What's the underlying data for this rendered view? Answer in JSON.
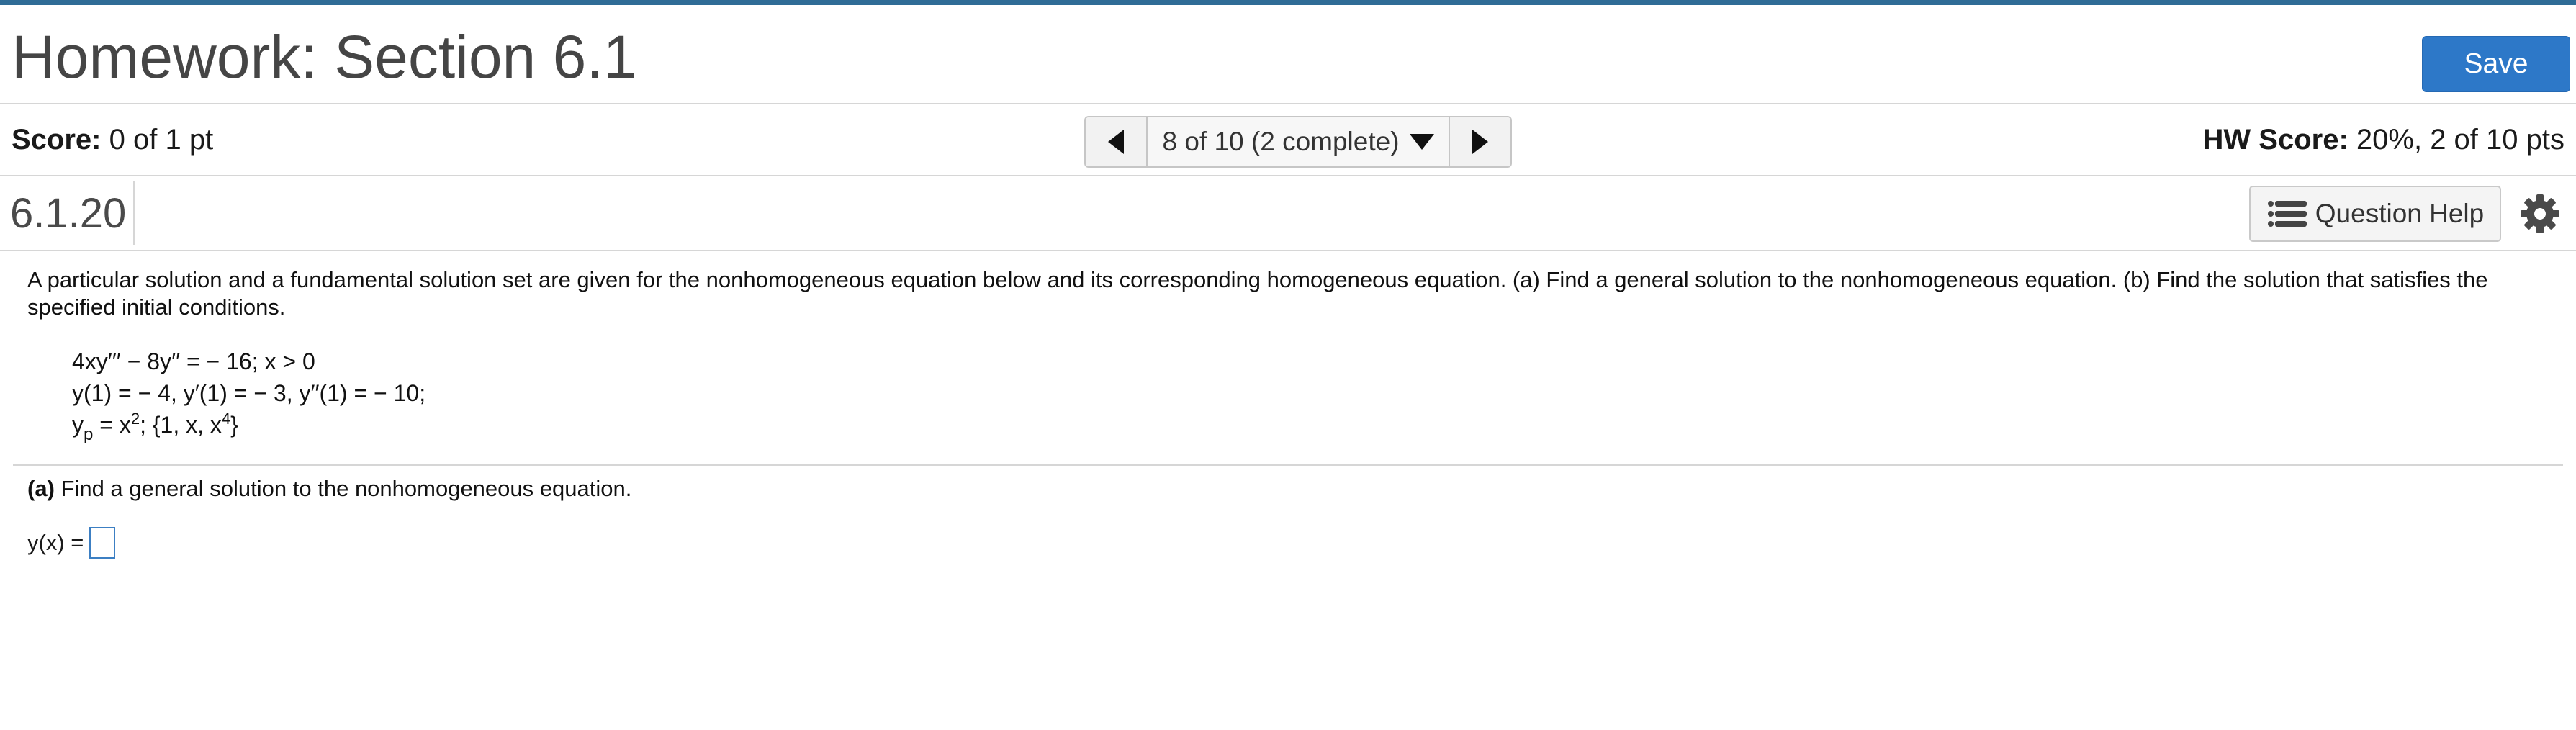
{
  "header": {
    "title": "Homework: Section 6.1",
    "save_label": "Save"
  },
  "score": {
    "label": "Score:",
    "value": "0 of 1 pt",
    "hw_label": "HW Score:",
    "hw_value": "20%, 2 of 10 pts"
  },
  "nav": {
    "status": "8 of 10 (2 complete)"
  },
  "question": {
    "id": "6.1.20",
    "help_label": "Question Help",
    "prompt": "A particular solution and a fundamental solution set are given for the nonhomogeneous equation below and its corresponding homogeneous equation. (a) Find a general solution to the nonhomogeneous equation. (b) Find the solution that satisfies the specified initial conditions.",
    "equation": "4xy′′′ − 8y′′ = − 16; x > 0",
    "initial_conditions": "y(1) = − 4, y′(1) = − 3, y′′(1) = − 10;",
    "yp_var": "y",
    "yp_sub": "p",
    "yp_rhs_pre": " = x",
    "yp_rhs_exp": "2",
    "yp_set_pre": "; {1, x, x",
    "yp_set_exp": "4",
    "yp_set_post": "}"
  },
  "part_a": {
    "label": "(a)",
    "text": " Find a general solution to the nonhomogeneous equation.",
    "answer_label": "y(x) ="
  },
  "icons": {
    "list": "list-icon",
    "gear": "gear-icon",
    "prev": "triangle-left-icon",
    "next": "triangle-right-icon",
    "dropdown": "triangle-down-icon"
  },
  "colors": {
    "accent_stripe": "#2f6c96",
    "save_button": "#2d78c8",
    "answer_box_border": "#3c7fc3"
  }
}
